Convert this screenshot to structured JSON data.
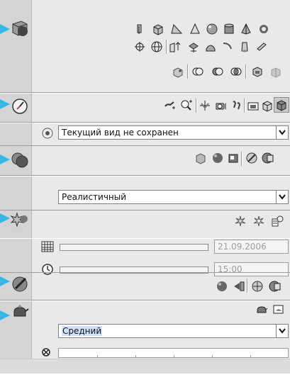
{
  "view": {
    "named_view_selected": "Текущий вид не сохранен"
  },
  "visual_style": {
    "selected": "Реалистичный"
  },
  "sun_time": {
    "date": "21.09.2006",
    "time": "15:00"
  },
  "render": {
    "quality_selected": "Средний"
  },
  "colors": {
    "accent": "#38b7e5",
    "strip": "#d4d4d4",
    "panel": "#e9e9e9"
  }
}
